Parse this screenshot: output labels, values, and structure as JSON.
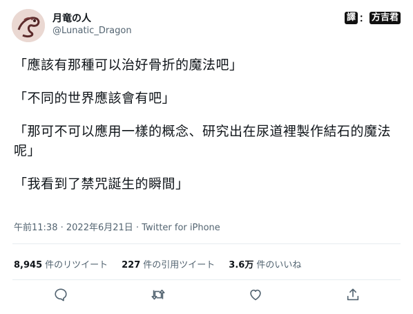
{
  "account": {
    "display_name": "月竜の人",
    "handle": "@Lunatic_Dragon"
  },
  "translator_badge": {
    "label": "譯",
    "separator": "：",
    "name": "方吉君"
  },
  "tweet": {
    "lines": [
      "「應該有那種可以治好骨折的魔法吧」",
      "「不同的世界應該會有吧」",
      "「那可不可以應用一樣的概念、研究出在尿道裡製作結石的魔法呢」",
      "「我看到了禁咒誕生的瞬間」"
    ]
  },
  "meta": {
    "time": "午前11:38",
    "date": "2022年6月21日",
    "source": "Twitter for iPhone",
    "dot": " · "
  },
  "stats": {
    "retweets_count": "8,945",
    "retweets_label": "件のリツイート",
    "quotes_count": "227",
    "quotes_label": "件の引用ツイート",
    "likes_count": "3.6万",
    "likes_label": "件のいいね"
  },
  "icons": {
    "reply": "reply-icon",
    "retweet": "retweet-icon",
    "like": "heart-icon",
    "share": "share-icon"
  }
}
